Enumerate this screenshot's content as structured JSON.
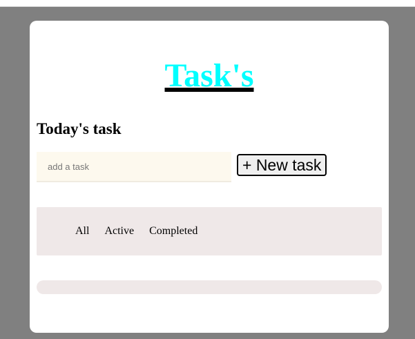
{
  "header": {
    "title": "Task's"
  },
  "section": {
    "heading": "Today's task"
  },
  "task_input": {
    "placeholder": "add a task",
    "value": ""
  },
  "new_task_button": {
    "label": "+ New task"
  },
  "filters": [
    {
      "label": "All"
    },
    {
      "label": "Active"
    },
    {
      "label": "Completed"
    }
  ],
  "colors": {
    "backdrop": "#808080",
    "card": "#ffffff",
    "title": "#00ffff",
    "input_bg": "#fdf9ee",
    "panel_bg": "#efe8e8"
  }
}
